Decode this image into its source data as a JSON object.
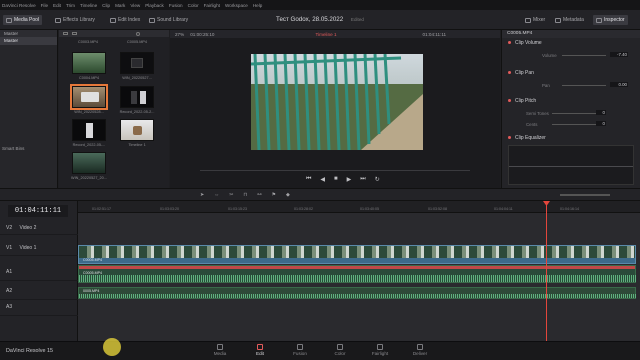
{
  "menu": [
    "DaVinci Resolve",
    "File",
    "Edit",
    "Trim",
    "Timeline",
    "Clip",
    "Mark",
    "View",
    "Playback",
    "Fusion",
    "Color",
    "Fairlight",
    "Workspace",
    "Help"
  ],
  "toolbar": {
    "media_pool": "Media Pool",
    "effects": "Effects Library",
    "edit_index": "Edit Index",
    "sound_library": "Sound Library",
    "project_title": "Тест Godox, 28.05.2022",
    "edited": "Edited",
    "mixer": "Mixer",
    "metadata": "Metadata",
    "inspector": "Inspector"
  },
  "media_pool": {
    "root": "Master",
    "smart_bins": "Smart Bins",
    "clips": [
      {
        "name": "C0003.MP4",
        "active": false
      },
      {
        "name": "C0005.MP4",
        "active": false
      },
      {
        "name": "C0004.MP4",
        "active": false
      },
      {
        "name": "WIN_20220527...",
        "active": false
      },
      {
        "name": "WIN_20220528...",
        "active": true
      },
      {
        "name": "Record_2022-05-2...",
        "active": false
      },
      {
        "name": "Record_2022-05-...",
        "active": false
      },
      {
        "name": "Timeline 1",
        "active": false
      },
      {
        "name": "WIN_20220527_20...",
        "active": false
      }
    ]
  },
  "viewer": {
    "zoom": "27%",
    "source_timecode": "01:00:25:10",
    "timeline_name": "Timeline 1",
    "record_timecode": "01:04:11:11"
  },
  "inspector": {
    "clip_name": "C0005.MP4",
    "clip_volume": "Clip Volume",
    "volume_label": "Volume",
    "volume_value": "-7.40",
    "clip_pan": "Clip Pan",
    "pan_label": "Pan",
    "pan_value": "0.00",
    "clip_pitch": "Clip Pitch",
    "semitones_label": "Semi Tones",
    "semitones_value": "0",
    "cents_label": "Cents",
    "cents_value": "0",
    "clip_equalizer": "Clip Equalizer"
  },
  "timeline": {
    "timecode": "01:04:11:11",
    "ruler": [
      "01:02:51:17",
      "01:03:03:20",
      "01:03:15:23",
      "01:03:28:02",
      "01:03:40:05",
      "01:03:52:08",
      "01:04:04:11",
      "01:04:16:14"
    ],
    "tracks": [
      {
        "id": "V2",
        "name": "Video 2"
      },
      {
        "id": "V1",
        "name": "Video 1"
      },
      {
        "id": "A1",
        "name": ""
      },
      {
        "id": "A2",
        "name": ""
      },
      {
        "id": "A3",
        "name": ""
      }
    ],
    "clip_v1": "C0005.MP4",
    "clip_a1": "C0005.MP4",
    "clip_a2": "0005.MP4"
  },
  "pages": [
    {
      "label": "Media",
      "active": false
    },
    {
      "label": "Edit",
      "active": true
    },
    {
      "label": "Fusion",
      "active": false
    },
    {
      "label": "Color",
      "active": false
    },
    {
      "label": "Fairlight",
      "active": false
    },
    {
      "label": "Deliver",
      "active": false
    }
  ],
  "app_name": "DaVinci Resolve 15"
}
